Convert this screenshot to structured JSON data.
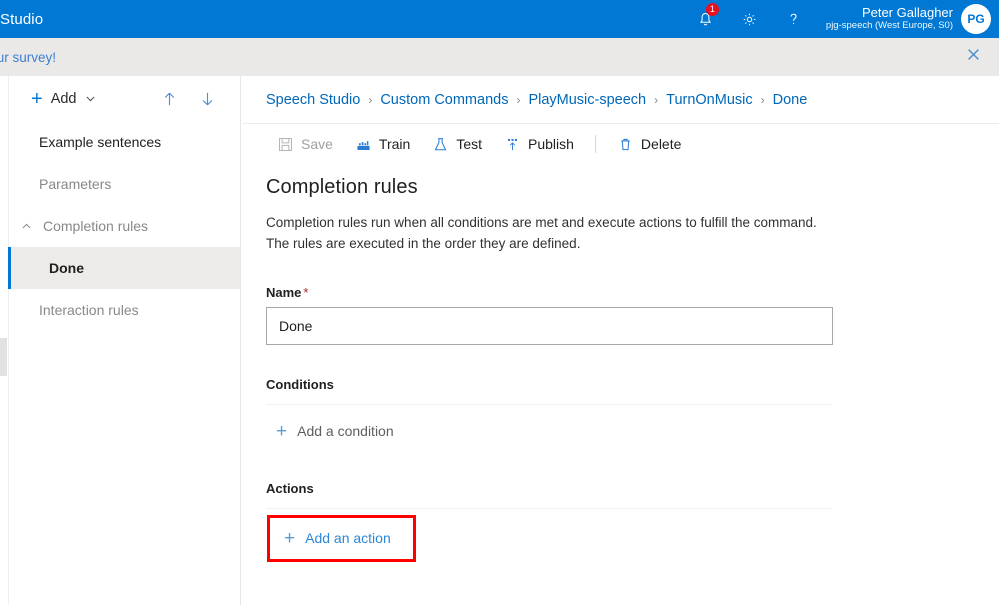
{
  "topbar": {
    "app_title": "Studio",
    "notification_count": "1",
    "notification_icon": "bell-icon",
    "settings_icon": "gear-icon",
    "help_icon": "question-mark-icon",
    "user_name": "Peter Gallagher",
    "user_subtitle": "pjg-speech (West Europe, S0)",
    "avatar_initials": "PG",
    "accent_color": "#0078d4",
    "badge_color": "#e81123"
  },
  "banner": {
    "text": "e our survey!",
    "close_icon": "close-icon"
  },
  "sidebar": {
    "add_label": "Add",
    "add_icon": "plus-icon",
    "add_caret_icon": "chevron-down-icon",
    "move_up_icon": "arrow-up-icon",
    "move_down_icon": "arrow-down-icon",
    "items": [
      {
        "label": "Example sentences",
        "state": "normal"
      },
      {
        "label": "Parameters",
        "state": "muted"
      },
      {
        "label": "Completion rules",
        "state": "muted",
        "caret_icon": "chevron-up-icon"
      },
      {
        "label": "Done",
        "state": "selected"
      },
      {
        "label": "Interaction rules",
        "state": "muted"
      }
    ]
  },
  "breadcrumb": {
    "separator": "›",
    "items": [
      {
        "label": "Speech Studio"
      },
      {
        "label": "Custom Commands"
      },
      {
        "label": "PlayMusic-speech"
      },
      {
        "label": "TurnOnMusic"
      },
      {
        "label": "Done"
      }
    ]
  },
  "commandbar": {
    "save": {
      "label": "Save",
      "icon": "save-icon",
      "disabled": true
    },
    "train": {
      "label": "Train",
      "icon": "train-icon",
      "disabled": false
    },
    "test": {
      "label": "Test",
      "icon": "flask-icon",
      "disabled": false
    },
    "publish": {
      "label": "Publish",
      "icon": "publish-icon",
      "disabled": false
    },
    "delete": {
      "label": "Delete",
      "icon": "trash-icon",
      "disabled": false
    }
  },
  "main": {
    "page_title": "Completion rules",
    "description_line1": "Completion rules run when all conditions are met and execute actions to fulfill the command.",
    "description_line2": "The rules are executed in the order they are defined.",
    "name_label": "Name",
    "name_required_mark": "*",
    "name_value": "Done",
    "conditions_title": "Conditions",
    "add_condition_label": "Add a condition",
    "add_condition_icon": "plus-icon",
    "actions_title": "Actions",
    "add_action_label": "Add an action",
    "add_action_icon": "plus-icon",
    "highlight_color": "#ff0000"
  }
}
